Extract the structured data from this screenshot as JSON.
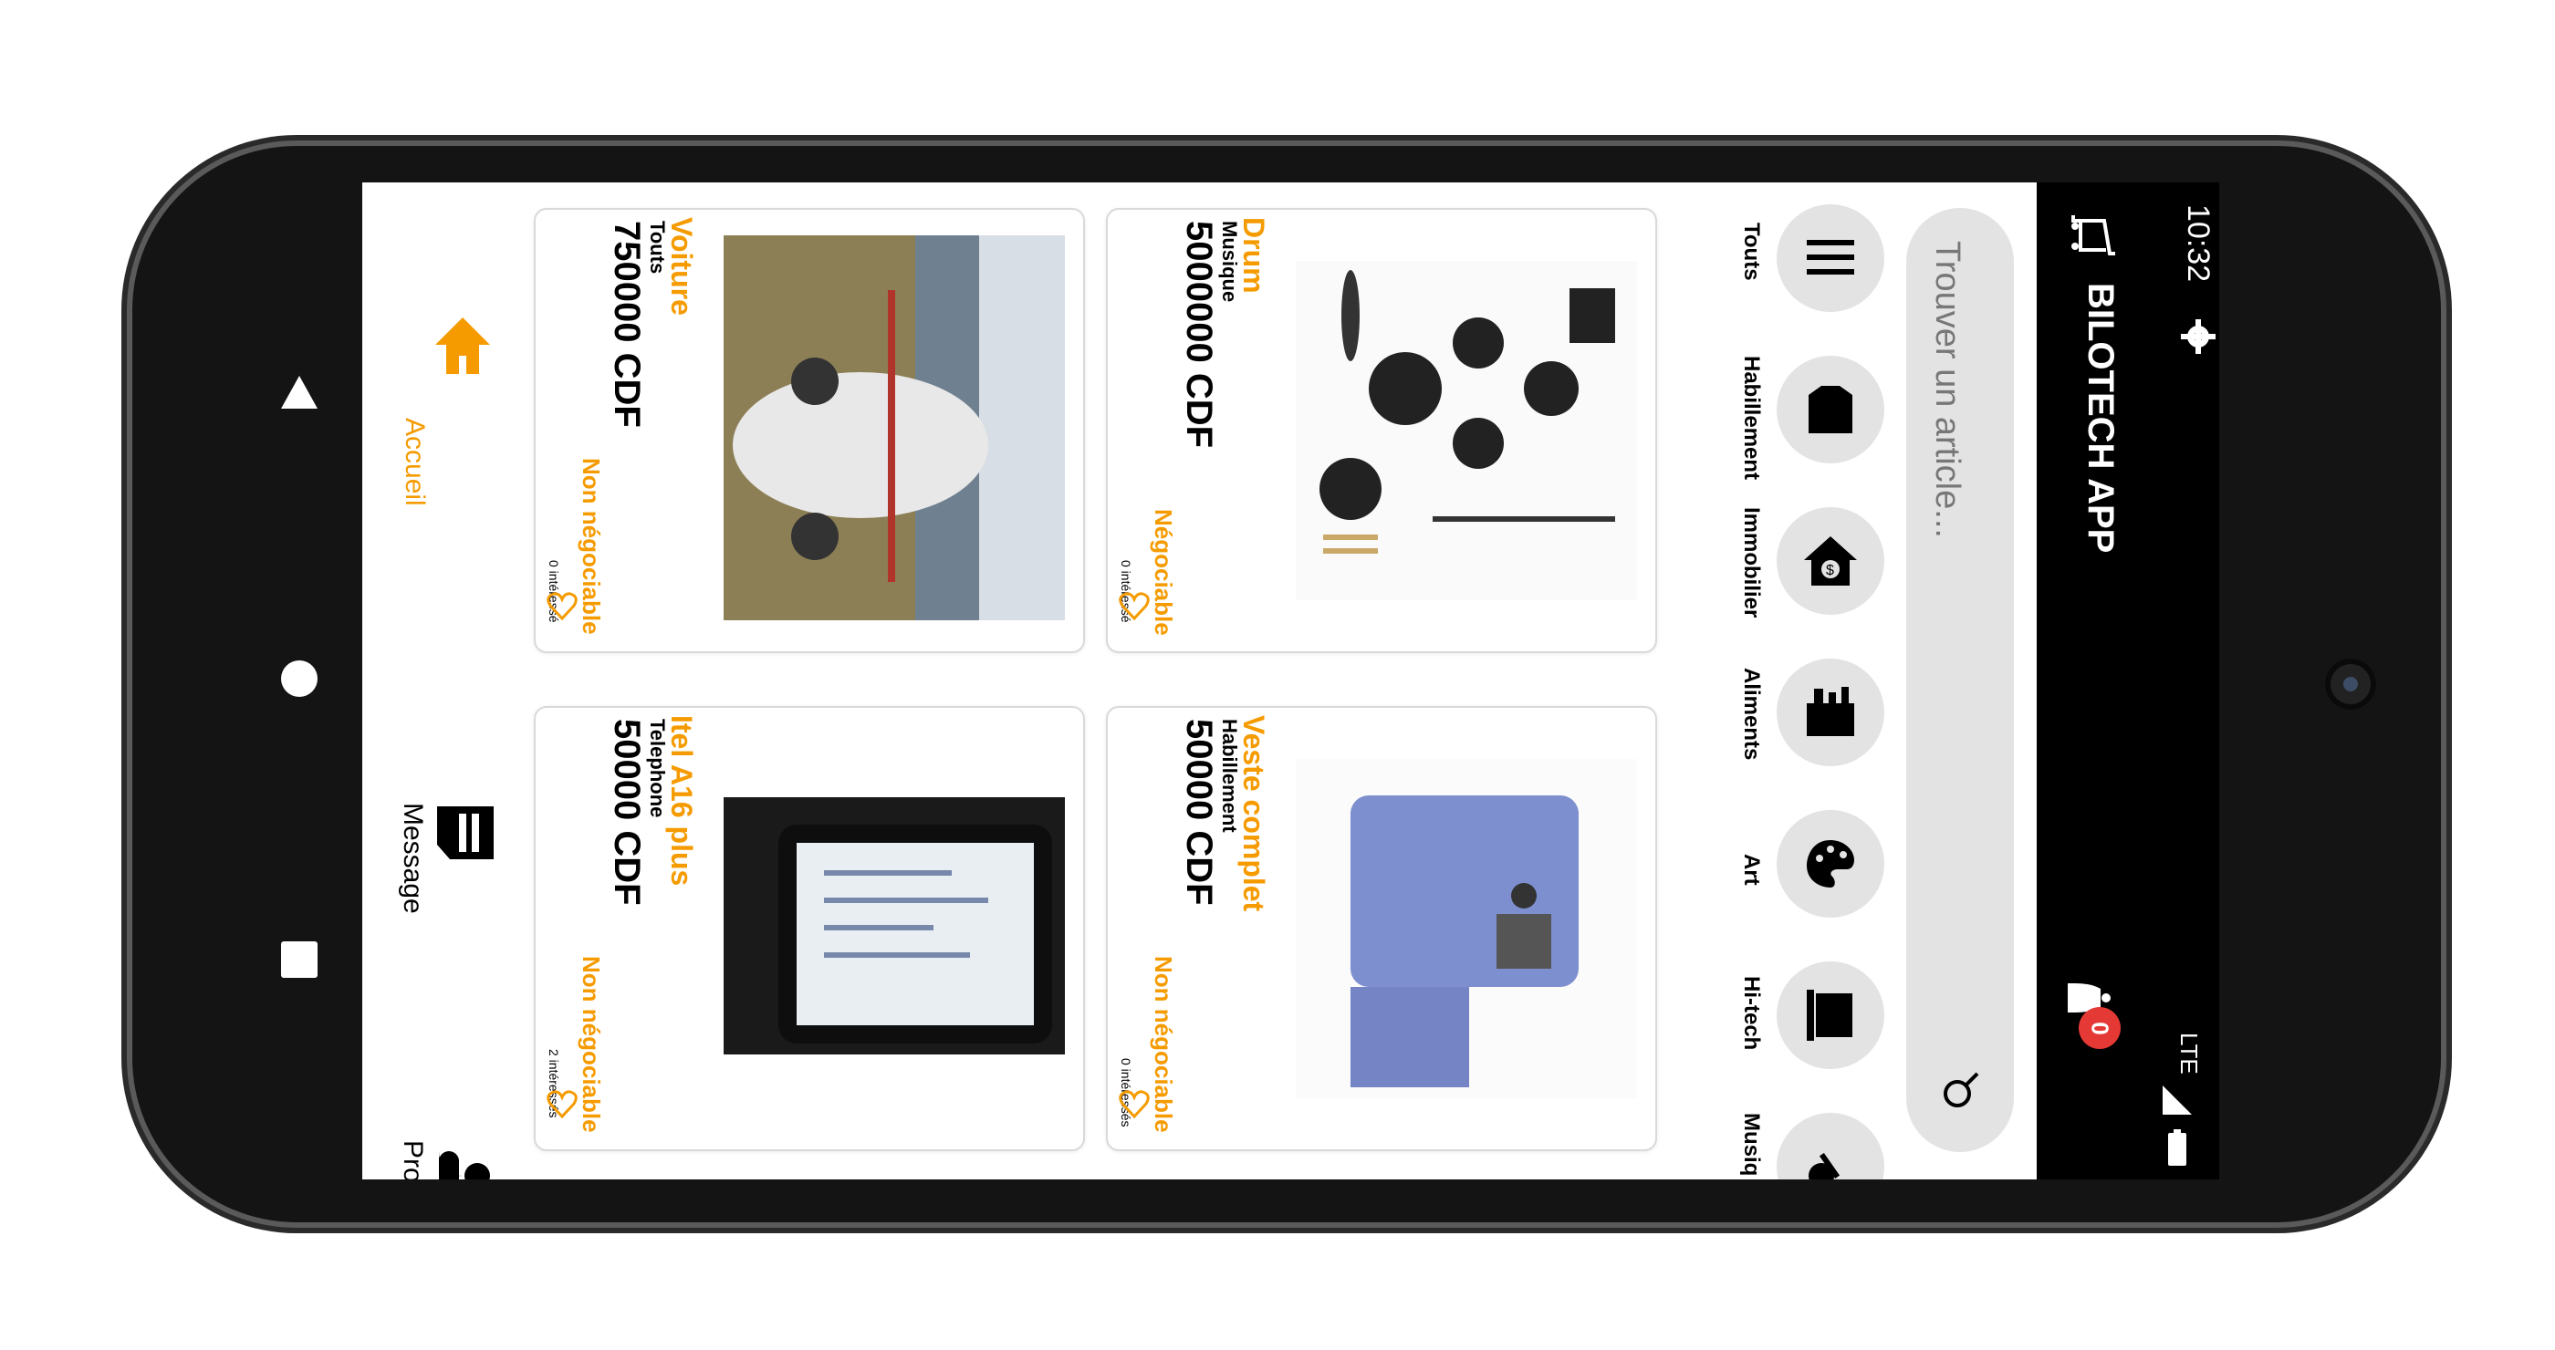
{
  "app": {
    "title": "BILOTECH APP",
    "notification_count": "0"
  },
  "status": {
    "time": "10:32",
    "network": "LTE"
  },
  "search": {
    "placeholder": "Trouver un article..."
  },
  "categories": [
    {
      "label": "Touts",
      "icon": "list-icon"
    },
    {
      "label": "Habillement",
      "icon": "shirt-icon"
    },
    {
      "label": "Immobilier",
      "icon": "house-money-icon"
    },
    {
      "label": "Aliments",
      "icon": "groceries-icon"
    },
    {
      "label": "Art",
      "icon": "palette-icon"
    },
    {
      "label": "Hi-tech",
      "icon": "laptop-icon"
    },
    {
      "label": "Musiq",
      "icon": "guitar-icon"
    }
  ],
  "products": [
    {
      "title": "Drum",
      "category": "Musique",
      "price": "5000000 CDF",
      "negotiation": "Négociable",
      "interest": "0 intéressé"
    },
    {
      "title": "Voiture",
      "category": "Touts",
      "price": "750000 CDF",
      "negotiation": "Non négociable",
      "interest": "0 intéressé"
    },
    {
      "title": "Veste complet",
      "category": "Habillement",
      "price": "50000 CDF",
      "negotiation": "Non négociable",
      "interest": "0 intéressés"
    },
    {
      "title": "Itel A16 plus",
      "category": "Telephone",
      "price": "50000 CDF",
      "negotiation": "Non négociable",
      "interest": "2 intéressés"
    }
  ],
  "bottom_nav": {
    "home": "Accueil",
    "message": "Message",
    "profile": "Profile"
  },
  "colors": {
    "accent": "#f59b00",
    "badge": "#e53935"
  }
}
